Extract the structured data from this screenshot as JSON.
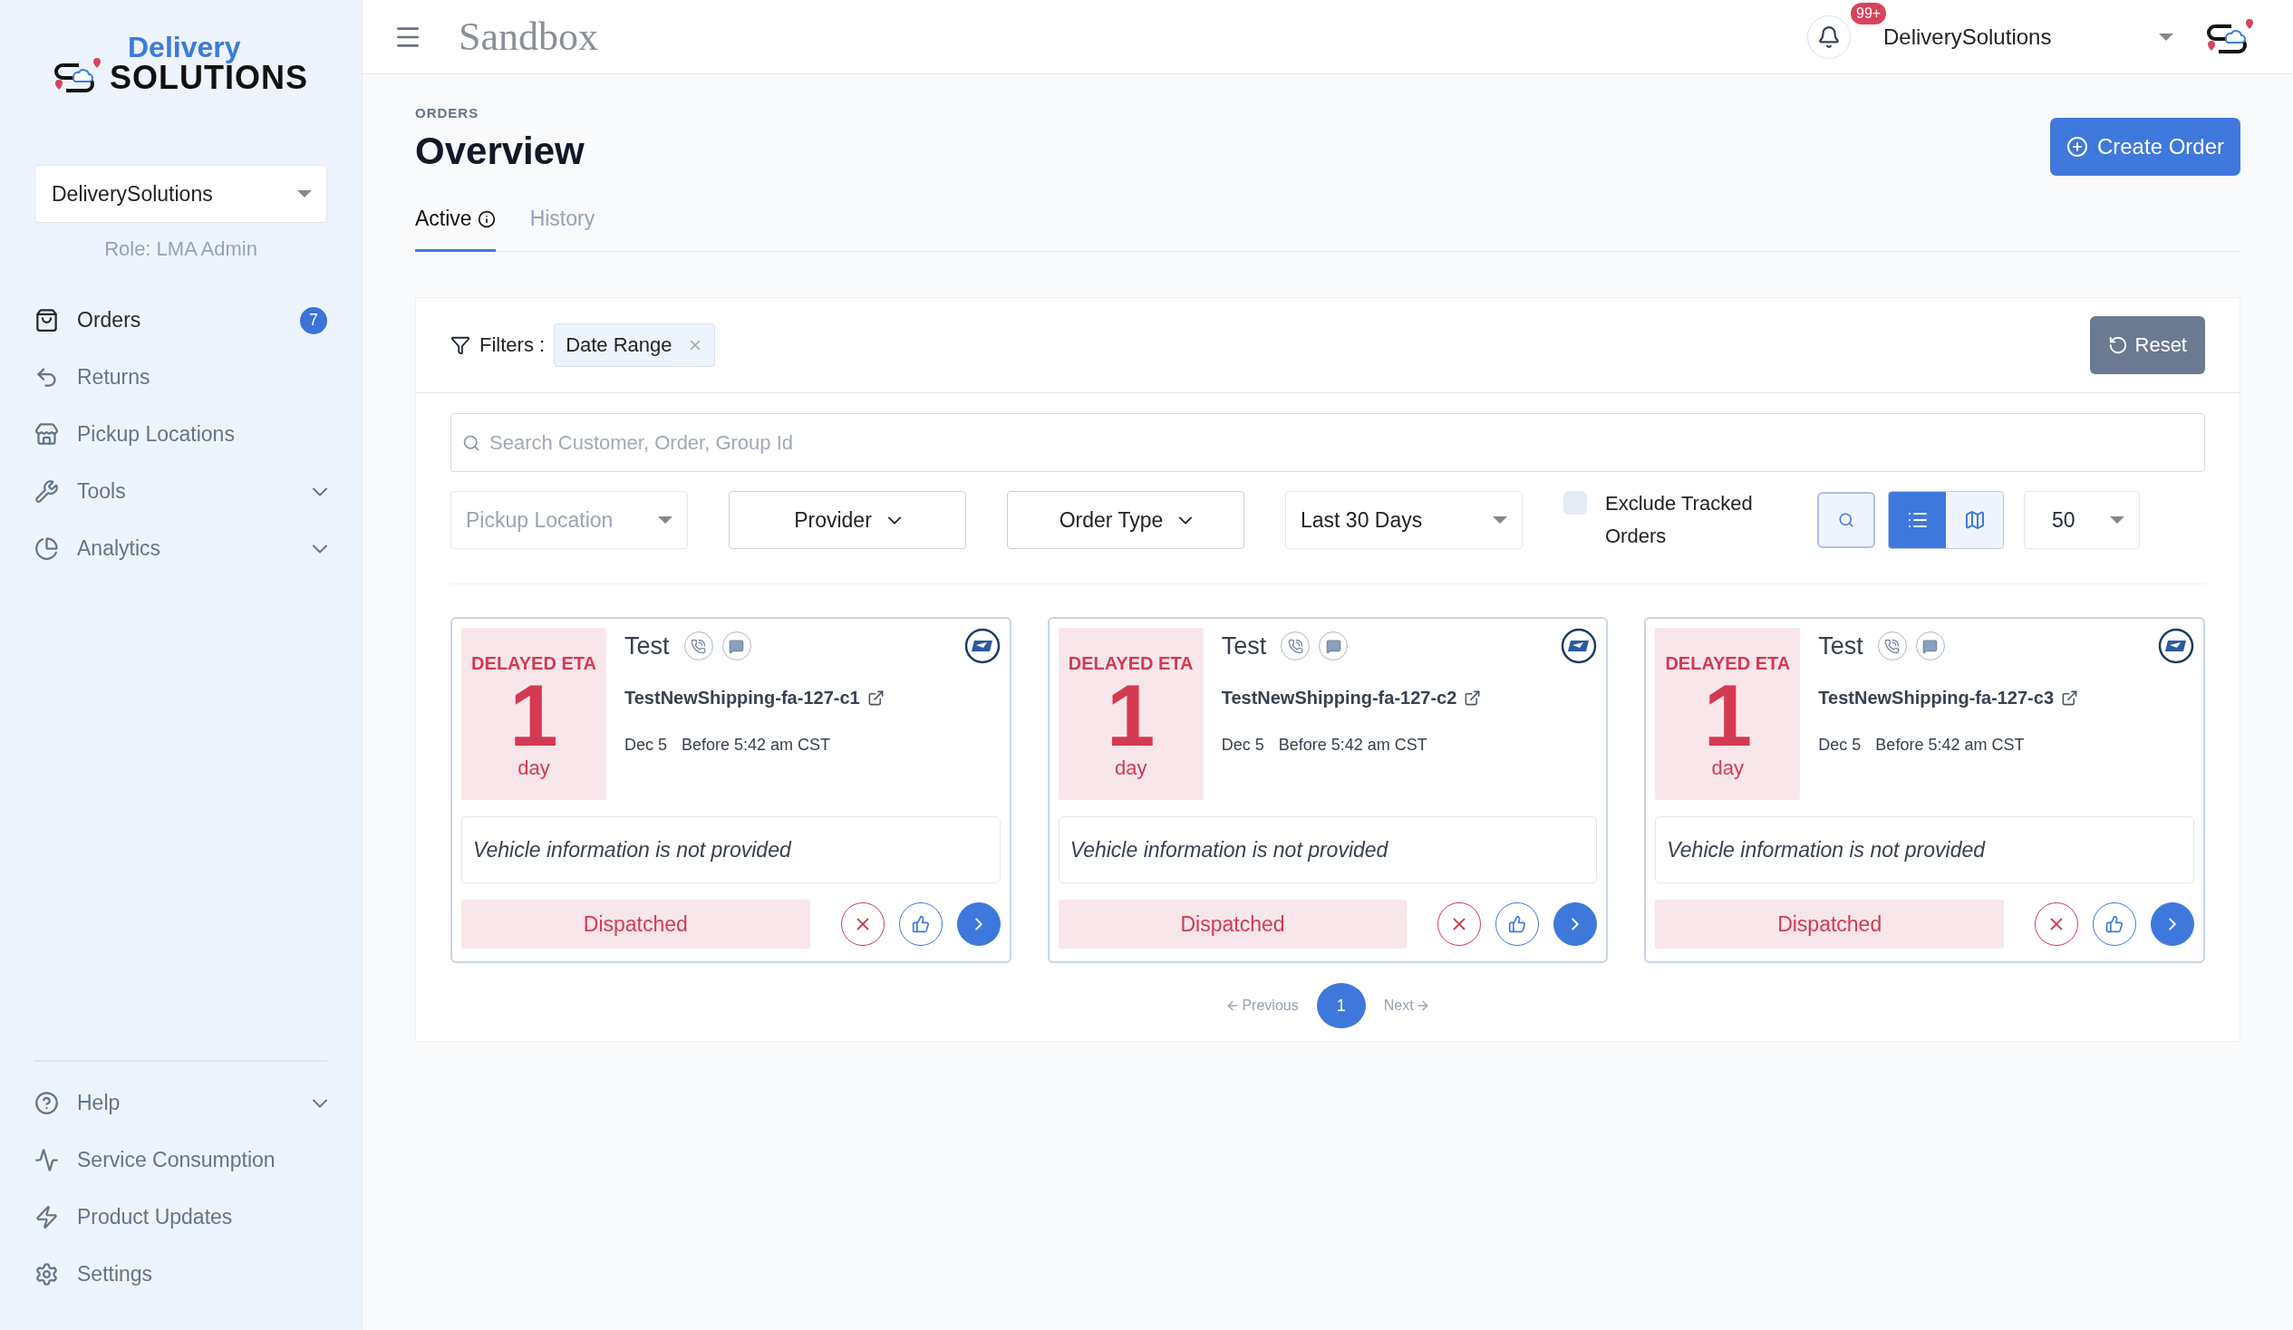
{
  "sidebar": {
    "logo": {
      "top": "Delivery",
      "bottom": "SOLUTIONS"
    },
    "account_select": {
      "value": "DeliverySolutions"
    },
    "role": "Role: LMA Admin",
    "nav": [
      {
        "label": "Orders",
        "selected": true,
        "badge": "7"
      },
      {
        "label": "Returns",
        "selected": false
      },
      {
        "label": "Pickup Locations",
        "selected": false
      },
      {
        "label": "Tools",
        "selected": false,
        "expanded": false
      },
      {
        "label": "Analytics",
        "selected": false,
        "expanded": false
      }
    ],
    "bottom_nav": [
      {
        "label": "Help",
        "selected": false,
        "expanded": false
      },
      {
        "label": "Service Consumption",
        "selected": false
      },
      {
        "label": "Product Updates",
        "selected": false
      },
      {
        "label": "Settings",
        "selected": false
      }
    ]
  },
  "header": {
    "title": "Sandbox",
    "notifications_badge": "99+",
    "account": "DeliverySolutions"
  },
  "page": {
    "breadcrumb": "ORDERS",
    "title": "Overview",
    "create_button": "Create Order",
    "tabs": [
      {
        "label": "Active",
        "selected": true,
        "info": true
      },
      {
        "label": "History",
        "selected": false,
        "info": false
      }
    ]
  },
  "filters": {
    "label": "Filters :",
    "chips": [
      {
        "label": "Date Range"
      }
    ],
    "reset": "Reset",
    "search": {
      "placeholder": "Search Customer, Order, Group Id"
    },
    "dropdowns": [
      {
        "kind": "select",
        "placeholder": "Pickup Location"
      },
      {
        "kind": "menu",
        "value": "Provider"
      },
      {
        "kind": "menu",
        "value": "Order Type"
      },
      {
        "kind": "select",
        "value": "Last 30 Days"
      }
    ],
    "exclude_tracked": {
      "label": "Exclude Tracked Orders",
      "checked": false
    },
    "view_modes": [
      {
        "selected": true
      },
      {
        "selected": false
      }
    ],
    "page_size": "50"
  },
  "orders": [
    {
      "eta_label": "DELAYED ETA",
      "eta_value": "1",
      "eta_unit": "day",
      "customer": "Test",
      "order_id": "TestNewShipping-fa-127-c1",
      "date": "Dec 5",
      "window": "Before 5:42 am CST",
      "vehicle_info": "Vehicle information is not provided",
      "status": "Dispatched"
    },
    {
      "eta_label": "DELAYED ETA",
      "eta_value": "1",
      "eta_unit": "day",
      "customer": "Test",
      "order_id": "TestNewShipping-fa-127-c2",
      "date": "Dec 5",
      "window": "Before 5:42 am CST",
      "vehicle_info": "Vehicle information is not provided",
      "status": "Dispatched"
    },
    {
      "eta_label": "DELAYED ETA",
      "eta_value": "1",
      "eta_unit": "day",
      "customer": "Test",
      "order_id": "TestNewShipping-fa-127-c3",
      "date": "Dec 5",
      "window": "Before 5:42 am CST",
      "vehicle_info": "Vehicle information is not provided",
      "status": "Dispatched"
    }
  ],
  "pagination": {
    "previous": "Previous",
    "next": "Next",
    "pages": [
      {
        "label": "1",
        "selected": true
      }
    ]
  }
}
